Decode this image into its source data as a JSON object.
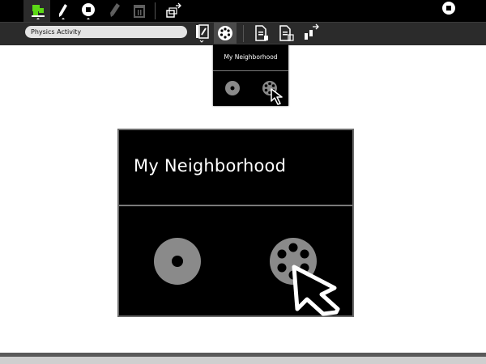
{
  "toolbar": {
    "activity_tab": {
      "icon": "activity-icon"
    },
    "edit_tab": {
      "icon": "pencil-icon"
    },
    "stop_button": {
      "icon": "stop-icon"
    },
    "erase_button": {
      "icon": "eraser-icon"
    },
    "trash_button": {
      "icon": "trash-icon"
    },
    "share_button": {
      "icon": "share-icon"
    },
    "stop_right_button": {
      "icon": "stop-icon"
    }
  },
  "secondary_toolbar": {
    "title_value": "Physics Activity",
    "journal_button": {
      "icon": "journal-notebook-icon"
    },
    "neighborhood_button": {
      "icon": "neighborhood-icon"
    },
    "copy_button": {
      "icon": "copy-document-icon"
    },
    "paste_button": {
      "icon": "paste-document-icon"
    },
    "network_button": {
      "icon": "network-icon"
    }
  },
  "palette": {
    "title": "My Neighborhood"
  },
  "zoomed_view": {
    "title": "My Neighborhood"
  },
  "colors": {
    "toolbar_bg": "#000000",
    "secondary_bg": "#2b2b2b",
    "accent_green": "#5cd916",
    "icon_gray": "#8a8a8a"
  }
}
